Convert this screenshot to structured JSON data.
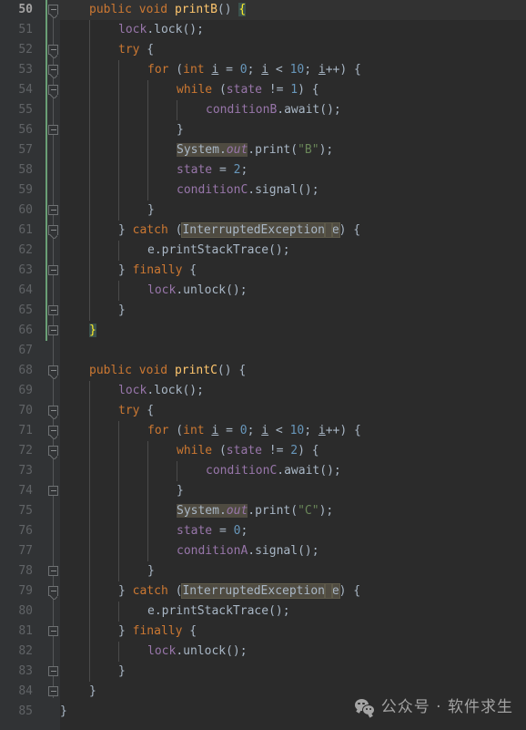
{
  "editor": {
    "theme": "darcula",
    "language": "java",
    "first_line": 50,
    "last_line": 85,
    "active_line": 50,
    "colors": {
      "background": "#2b2b2b",
      "gutter_background": "#313335",
      "current_line": "#323232",
      "line_number": "#606366",
      "line_number_active": "#a4a3a3",
      "keyword": "#cc7832",
      "number": "#6897bb",
      "string": "#6a8759",
      "field": "#9876aa",
      "method": "#ffc66d",
      "default_text": "#a9b7c6",
      "brace_match_fg": "#ffef28",
      "brace_match_bg": "#3b514d",
      "highlight_bg": "#4f4b41",
      "vcs_change_bar": "#6a9f76",
      "indent_guide": "#4b4b4b"
    },
    "lines": [
      {
        "n": 50,
        "indent": 1,
        "fold": "open",
        "vcs": true,
        "active": true,
        "tokens": [
          {
            "t": "public",
            "c": "kw"
          },
          {
            "t": " ",
            "c": "plain"
          },
          {
            "t": "void",
            "c": "kw"
          },
          {
            "t": " ",
            "c": "plain"
          },
          {
            "t": "printB",
            "c": "mname"
          },
          {
            "t": "()",
            "c": "plain"
          },
          {
            "t": " ",
            "c": "plain"
          },
          {
            "t": "{",
            "c": "brace-match"
          }
        ]
      },
      {
        "n": 51,
        "indent": 2,
        "fold": "none",
        "vcs": true,
        "tokens": [
          {
            "t": "lock",
            "c": "fld"
          },
          {
            "t": ".",
            "c": "plain"
          },
          {
            "t": "lock",
            "c": "plain"
          },
          {
            "t": "();",
            "c": "plain"
          }
        ]
      },
      {
        "n": 52,
        "indent": 2,
        "fold": "open",
        "vcs": true,
        "tokens": [
          {
            "t": "try",
            "c": "kw"
          },
          {
            "t": " {",
            "c": "plain"
          }
        ]
      },
      {
        "n": 53,
        "indent": 3,
        "fold": "open",
        "vcs": true,
        "tokens": [
          {
            "t": "for",
            "c": "kw"
          },
          {
            "t": " (",
            "c": "plain"
          },
          {
            "t": "int",
            "c": "kw"
          },
          {
            "t": " ",
            "c": "plain"
          },
          {
            "t": "i",
            "c": "lvar"
          },
          {
            "t": " = ",
            "c": "plain"
          },
          {
            "t": "0",
            "c": "num"
          },
          {
            "t": "; ",
            "c": "plain"
          },
          {
            "t": "i",
            "c": "lvar"
          },
          {
            "t": " < ",
            "c": "plain"
          },
          {
            "t": "10",
            "c": "num"
          },
          {
            "t": "; ",
            "c": "plain"
          },
          {
            "t": "i",
            "c": "lvar"
          },
          {
            "t": "++) {",
            "c": "plain"
          }
        ]
      },
      {
        "n": 54,
        "indent": 4,
        "fold": "open",
        "vcs": true,
        "tokens": [
          {
            "t": "while",
            "c": "kw"
          },
          {
            "t": " (",
            "c": "plain"
          },
          {
            "t": "state",
            "c": "fld"
          },
          {
            "t": " != ",
            "c": "plain"
          },
          {
            "t": "1",
            "c": "num"
          },
          {
            "t": ") {",
            "c": "plain"
          }
        ]
      },
      {
        "n": 55,
        "indent": 5,
        "fold": "none",
        "vcs": true,
        "tokens": [
          {
            "t": "conditionB",
            "c": "fld"
          },
          {
            "t": ".",
            "c": "plain"
          },
          {
            "t": "await",
            "c": "plain"
          },
          {
            "t": "();",
            "c": "plain"
          }
        ]
      },
      {
        "n": 56,
        "indent": 4,
        "fold": "close",
        "vcs": true,
        "tokens": [
          {
            "t": "}",
            "c": "plain"
          }
        ]
      },
      {
        "n": 57,
        "indent": 4,
        "fold": "none",
        "vcs": true,
        "tokens": [
          {
            "t": "System",
            "c": "cls hl-search"
          },
          {
            "t": ".",
            "c": "plain hl-search"
          },
          {
            "t": "out",
            "c": "stat hl-search"
          },
          {
            "t": ".",
            "c": "plain"
          },
          {
            "t": "print",
            "c": "plain"
          },
          {
            "t": "(",
            "c": "plain"
          },
          {
            "t": "\"B\"",
            "c": "str"
          },
          {
            "t": ");",
            "c": "plain"
          }
        ]
      },
      {
        "n": 58,
        "indent": 4,
        "fold": "none",
        "vcs": true,
        "tokens": [
          {
            "t": "state",
            "c": "fld"
          },
          {
            "t": " = ",
            "c": "plain"
          },
          {
            "t": "2",
            "c": "num"
          },
          {
            "t": ";",
            "c": "plain"
          }
        ]
      },
      {
        "n": 59,
        "indent": 4,
        "fold": "none",
        "vcs": true,
        "tokens": [
          {
            "t": "conditionC",
            "c": "fld"
          },
          {
            "t": ".",
            "c": "plain"
          },
          {
            "t": "signal",
            "c": "plain"
          },
          {
            "t": "();",
            "c": "plain"
          }
        ]
      },
      {
        "n": 60,
        "indent": 3,
        "fold": "close",
        "vcs": true,
        "tokens": [
          {
            "t": "}",
            "c": "plain"
          }
        ]
      },
      {
        "n": 61,
        "indent": 2,
        "fold": "open",
        "vcs": true,
        "tokens": [
          {
            "t": "} ",
            "c": "plain"
          },
          {
            "t": "catch",
            "c": "kw"
          },
          {
            "t": " (",
            "c": "plain"
          },
          {
            "t": "InterruptedException",
            "c": "cls hl-box"
          },
          {
            "t": " ",
            "c": "plain hl-box"
          },
          {
            "t": "e",
            "c": "plain hl-box"
          },
          {
            "t": ") {",
            "c": "plain"
          }
        ]
      },
      {
        "n": 62,
        "indent": 3,
        "fold": "none",
        "vcs": true,
        "tokens": [
          {
            "t": "e",
            "c": "plain"
          },
          {
            "t": ".",
            "c": "plain"
          },
          {
            "t": "printStackTrace",
            "c": "plain"
          },
          {
            "t": "();",
            "c": "plain"
          }
        ]
      },
      {
        "n": 63,
        "indent": 2,
        "fold": "close",
        "vcs": true,
        "tokens": [
          {
            "t": "} ",
            "c": "plain"
          },
          {
            "t": "finally",
            "c": "kw"
          },
          {
            "t": " {",
            "c": "plain"
          }
        ]
      },
      {
        "n": 64,
        "indent": 3,
        "fold": "none",
        "vcs": true,
        "tokens": [
          {
            "t": "lock",
            "c": "fld"
          },
          {
            "t": ".",
            "c": "plain"
          },
          {
            "t": "unlock",
            "c": "plain"
          },
          {
            "t": "();",
            "c": "plain"
          }
        ]
      },
      {
        "n": 65,
        "indent": 2,
        "fold": "close",
        "vcs": true,
        "tokens": [
          {
            "t": "}",
            "c": "plain"
          }
        ]
      },
      {
        "n": 66,
        "indent": 1,
        "fold": "close",
        "vcs": true,
        "tokens": [
          {
            "t": "}",
            "c": "brace-match"
          }
        ]
      },
      {
        "n": 67,
        "indent": 0,
        "fold": "none",
        "vcs": false,
        "tokens": []
      },
      {
        "n": 68,
        "indent": 1,
        "fold": "open",
        "vcs": false,
        "tokens": [
          {
            "t": "public",
            "c": "kw"
          },
          {
            "t": " ",
            "c": "plain"
          },
          {
            "t": "void",
            "c": "kw"
          },
          {
            "t": " ",
            "c": "plain"
          },
          {
            "t": "printC",
            "c": "mname"
          },
          {
            "t": "() {",
            "c": "plain"
          }
        ]
      },
      {
        "n": 69,
        "indent": 2,
        "fold": "none",
        "vcs": false,
        "tokens": [
          {
            "t": "lock",
            "c": "fld"
          },
          {
            "t": ".",
            "c": "plain"
          },
          {
            "t": "lock",
            "c": "plain"
          },
          {
            "t": "();",
            "c": "plain"
          }
        ]
      },
      {
        "n": 70,
        "indent": 2,
        "fold": "open",
        "vcs": false,
        "tokens": [
          {
            "t": "try",
            "c": "kw"
          },
          {
            "t": " {",
            "c": "plain"
          }
        ]
      },
      {
        "n": 71,
        "indent": 3,
        "fold": "open",
        "vcs": false,
        "tokens": [
          {
            "t": "for",
            "c": "kw"
          },
          {
            "t": " (",
            "c": "plain"
          },
          {
            "t": "int",
            "c": "kw"
          },
          {
            "t": " ",
            "c": "plain"
          },
          {
            "t": "i",
            "c": "lvar"
          },
          {
            "t": " = ",
            "c": "plain"
          },
          {
            "t": "0",
            "c": "num"
          },
          {
            "t": "; ",
            "c": "plain"
          },
          {
            "t": "i",
            "c": "lvar"
          },
          {
            "t": " < ",
            "c": "plain"
          },
          {
            "t": "10",
            "c": "num"
          },
          {
            "t": "; ",
            "c": "plain"
          },
          {
            "t": "i",
            "c": "lvar"
          },
          {
            "t": "++) {",
            "c": "plain"
          }
        ]
      },
      {
        "n": 72,
        "indent": 4,
        "fold": "open",
        "vcs": false,
        "tokens": [
          {
            "t": "while",
            "c": "kw"
          },
          {
            "t": " (",
            "c": "plain"
          },
          {
            "t": "state",
            "c": "fld"
          },
          {
            "t": " != ",
            "c": "plain"
          },
          {
            "t": "2",
            "c": "num"
          },
          {
            "t": ") {",
            "c": "plain"
          }
        ]
      },
      {
        "n": 73,
        "indent": 5,
        "fold": "none",
        "vcs": false,
        "tokens": [
          {
            "t": "conditionC",
            "c": "fld"
          },
          {
            "t": ".",
            "c": "plain"
          },
          {
            "t": "await",
            "c": "plain"
          },
          {
            "t": "();",
            "c": "plain"
          }
        ]
      },
      {
        "n": 74,
        "indent": 4,
        "fold": "close",
        "vcs": false,
        "tokens": [
          {
            "t": "}",
            "c": "plain"
          }
        ]
      },
      {
        "n": 75,
        "indent": 4,
        "fold": "none",
        "vcs": false,
        "tokens": [
          {
            "t": "System",
            "c": "cls hl-search"
          },
          {
            "t": ".",
            "c": "plain hl-search"
          },
          {
            "t": "out",
            "c": "stat hl-search"
          },
          {
            "t": ".",
            "c": "plain"
          },
          {
            "t": "print",
            "c": "plain"
          },
          {
            "t": "(",
            "c": "plain"
          },
          {
            "t": "\"C\"",
            "c": "str"
          },
          {
            "t": ");",
            "c": "plain"
          }
        ]
      },
      {
        "n": 76,
        "indent": 4,
        "fold": "none",
        "vcs": false,
        "tokens": [
          {
            "t": "state",
            "c": "fld"
          },
          {
            "t": " = ",
            "c": "plain"
          },
          {
            "t": "0",
            "c": "num"
          },
          {
            "t": ";",
            "c": "plain"
          }
        ]
      },
      {
        "n": 77,
        "indent": 4,
        "fold": "none",
        "vcs": false,
        "tokens": [
          {
            "t": "conditionA",
            "c": "fld"
          },
          {
            "t": ".",
            "c": "plain"
          },
          {
            "t": "signal",
            "c": "plain"
          },
          {
            "t": "();",
            "c": "plain"
          }
        ]
      },
      {
        "n": 78,
        "indent": 3,
        "fold": "close",
        "vcs": false,
        "tokens": [
          {
            "t": "}",
            "c": "plain"
          }
        ]
      },
      {
        "n": 79,
        "indent": 2,
        "fold": "open",
        "vcs": false,
        "tokens": [
          {
            "t": "} ",
            "c": "plain"
          },
          {
            "t": "catch",
            "c": "kw"
          },
          {
            "t": " (",
            "c": "plain"
          },
          {
            "t": "InterruptedException",
            "c": "cls hl-box"
          },
          {
            "t": " ",
            "c": "plain hl-box"
          },
          {
            "t": "e",
            "c": "plain hl-box"
          },
          {
            "t": ") {",
            "c": "plain"
          }
        ]
      },
      {
        "n": 80,
        "indent": 3,
        "fold": "none",
        "vcs": false,
        "tokens": [
          {
            "t": "e",
            "c": "plain"
          },
          {
            "t": ".",
            "c": "plain"
          },
          {
            "t": "printStackTrace",
            "c": "plain"
          },
          {
            "t": "();",
            "c": "plain"
          }
        ]
      },
      {
        "n": 81,
        "indent": 2,
        "fold": "close",
        "vcs": false,
        "tokens": [
          {
            "t": "} ",
            "c": "plain"
          },
          {
            "t": "finally",
            "c": "kw"
          },
          {
            "t": " {",
            "c": "plain"
          }
        ]
      },
      {
        "n": 82,
        "indent": 3,
        "fold": "none",
        "vcs": false,
        "tokens": [
          {
            "t": "lock",
            "c": "fld"
          },
          {
            "t": ".",
            "c": "plain"
          },
          {
            "t": "unlock",
            "c": "plain"
          },
          {
            "t": "();",
            "c": "plain"
          }
        ]
      },
      {
        "n": 83,
        "indent": 2,
        "fold": "close",
        "vcs": false,
        "tokens": [
          {
            "t": "}",
            "c": "plain"
          }
        ]
      },
      {
        "n": 84,
        "indent": 1,
        "fold": "close",
        "vcs": false,
        "tokens": [
          {
            "t": "}",
            "c": "plain"
          }
        ]
      },
      {
        "n": 85,
        "indent": 0,
        "fold": "none",
        "vcs": false,
        "tokens": [
          {
            "t": "}",
            "c": "plain"
          }
        ]
      }
    ]
  },
  "watermark": {
    "icon": "wechat-icon",
    "text": "公众号 · 软件求生"
  }
}
